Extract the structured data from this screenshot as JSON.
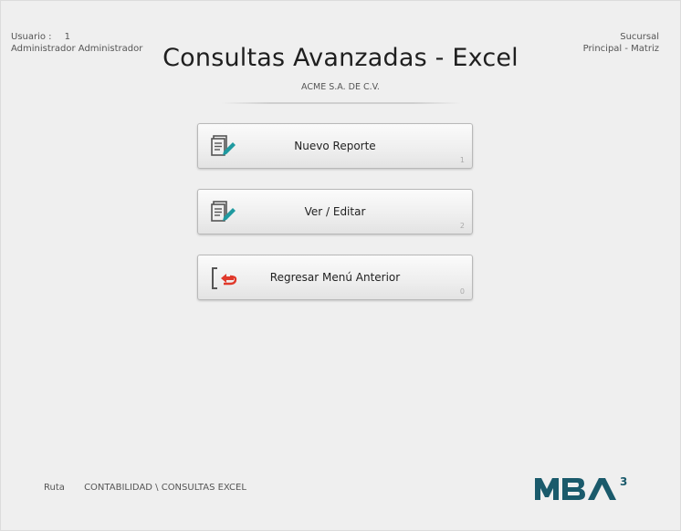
{
  "user": {
    "label": "Usuario :",
    "number": "1",
    "name": "Administrador Administrador"
  },
  "branch": {
    "label": "Sucursal",
    "name": "Principal - Matriz"
  },
  "title": "Consultas Avanzadas - Excel",
  "company": "ACME S.A. DE C.V.",
  "menu": [
    {
      "label": "Nuevo Reporte",
      "key": "1",
      "icon": "document-edit-icon"
    },
    {
      "label": "Ver / Editar",
      "key": "2",
      "icon": "document-edit-icon"
    },
    {
      "label": "Regresar Menú Anterior",
      "key": "0",
      "icon": "exit-back-icon"
    }
  ],
  "path": {
    "label": "Ruta",
    "value": "CONTABILIDAD \\ CONSULTAS EXCEL"
  },
  "logo": {
    "text": "MBA",
    "superscript": "3",
    "color": "#1a5a6b"
  },
  "colors": {
    "icon_teal": "#1f9aa0",
    "icon_red": "#e0392b"
  }
}
